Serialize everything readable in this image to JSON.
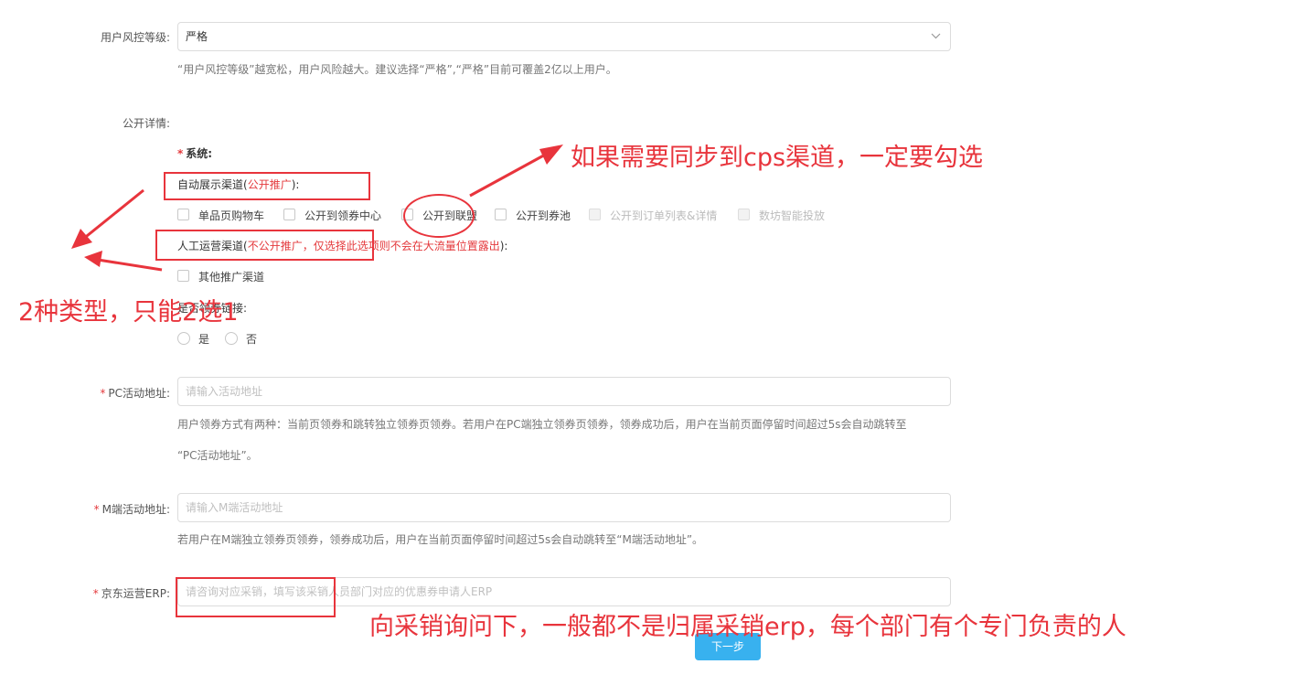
{
  "risk_level": {
    "label": "用户风控等级:",
    "value": "严格",
    "hint": "“用户风控等级”越宽松，用户风险越大。建议选择“严格”,“严格”目前可覆盖2亿以上用户。"
  },
  "public_details": {
    "label": "公开详情:",
    "system_label": "系统:",
    "auto_channel_label": "自动展示渠道",
    "auto_channel_note_open": "(",
    "auto_channel_note": "公开推广",
    "auto_channel_note_close": "):",
    "auto_options": [
      {
        "label": "单品页购物车",
        "disabled": false
      },
      {
        "label": "公开到领券中心",
        "disabled": false
      },
      {
        "label": "公开到联盟",
        "disabled": false
      },
      {
        "label": "公开到券池",
        "disabled": false
      },
      {
        "label": "公开到订单列表&详情",
        "disabled": true
      },
      {
        "label": "数坊智能投放",
        "disabled": true
      }
    ],
    "manual_channel_label": "人工运营渠道",
    "manual_channel_note_open": "(",
    "manual_channel_note": "不公开推广，仅选择此选项则不会在大流量位置露出",
    "manual_channel_note_close": "):",
    "manual_options": [
      {
        "label": "其他推广渠道"
      }
    ],
    "link_label": "是否领券链接:",
    "yes": "是",
    "no": "否"
  },
  "pc_url": {
    "label": "PC活动地址:",
    "placeholder": "请输入活动地址",
    "hint_line1": "用户领券方式有两种：当前页领券和跳转独立领券页领券。若用户在PC端独立领券页领券，领券成功后，用户在当前页面停留时间超过5s会自动跳转至",
    "hint_line2": "“PC活动地址”。"
  },
  "m_url": {
    "label": "M端活动地址:",
    "placeholder": "请输入M端活动地址",
    "hint": "若用户在M端独立领券页领券，领券成功后，用户在当前页面停留时间超过5s会自动跳转至“M端活动地址”。"
  },
  "erp": {
    "label": "京东运营ERP:",
    "placeholder": "请咨询对应采销，填写该采销人员部门对应的优惠券申请人ERP"
  },
  "next_button": "下一步",
  "annotations": {
    "sync_cps": "如果需要同步到cps渠道，一定要勾选",
    "choose_one": "2种类型，只能2选1",
    "ask_buyer": "向采销询问下，一般都不是归属采销erp，每个部门有个专门负责的人",
    "color": "#e8343c"
  },
  "colors": {
    "required": "#e4393c",
    "primary_button": "#38b1ef"
  }
}
